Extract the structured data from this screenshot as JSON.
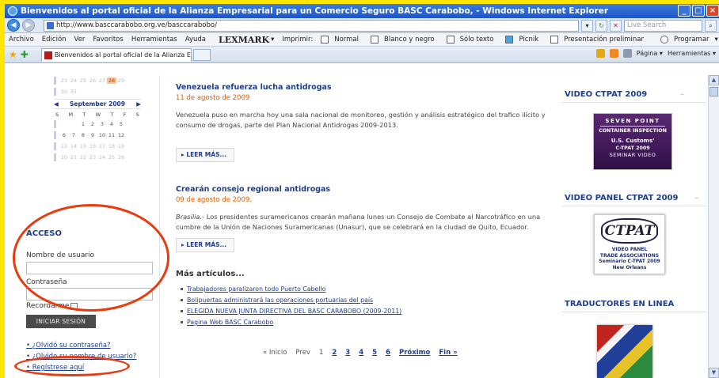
{
  "window": {
    "title": "Bienvenidos al portal oficial de la Alianza Empresarial para un Comercio Seguro BASC Carabobo, - Windows Internet Explorer"
  },
  "address_bar": {
    "url": "http://www.basccarabobo.org.ve/basccarabobo/",
    "search_placeholder": "Live Search"
  },
  "menu": {
    "items": [
      "Archivo",
      "Edición",
      "Ver",
      "Favoritos",
      "Herramientas",
      "Ayuda"
    ],
    "lexmark": "LEXMARK",
    "imprimir": "Imprimir:",
    "normal": "Normal",
    "blanco": "Blanco y negro",
    "solo_texto": "Sólo texto",
    "picnik": "Picnik",
    "presentacion": "Presentación preliminar",
    "programar": "Programar"
  },
  "tabs": {
    "active_label": "Bienvenidos al portal oficial de la Alianza Empresarial p...",
    "pagina": "Página",
    "herramientas": "Herramientas"
  },
  "calendar": {
    "prev_rows": [
      [
        "23",
        "24",
        "25",
        "26",
        "27",
        "28",
        "29"
      ],
      [
        "30",
        "31"
      ]
    ],
    "highlight_day": "28",
    "month": "September 2009",
    "weekdays": [
      "S",
      "M",
      "T",
      "W",
      "T",
      "F",
      "S"
    ],
    "weeks": [
      [
        "",
        "",
        "1",
        "2",
        "3",
        "4",
        "5"
      ],
      [
        "6",
        "7",
        "8",
        "9",
        "10",
        "11",
        "12"
      ],
      [
        "13",
        "14",
        "15",
        "16",
        "17",
        "18",
        "19"
      ],
      [
        "20",
        "21",
        "22",
        "23",
        "24",
        "25",
        "26"
      ]
    ]
  },
  "login": {
    "title": "ACCESO",
    "username_label": "Nombre de usuario",
    "password_label": "Contraseña",
    "remember_label": "Recordarme",
    "submit": "INICIAR SESIÓN",
    "links": [
      "¿Olvidó su contraseña?",
      "¿Olvido su nombre de usuario?",
      "Regístrese aquí"
    ]
  },
  "articles": [
    {
      "title": "Venezuela refuerza lucha antidrogas",
      "date": "11 de agosto de 2009",
      "body": "Venezuela puso en marcha hoy una sala nacional de monitoreo, gestión y análisis estratégico del trafico ilícito y consumo de drogas, parte del Plan Nacional Antidrogas 2009-2013.",
      "more": "LEER MÁS..."
    },
    {
      "title": "Crearán consejo regional antidrogas",
      "date": "09 de agosto de 2009.",
      "lead": "Brasilia.",
      "body": "- Los presidentes suramericanos crearán mañana lunes un Consejo de Combate al Narcotráfico en una cumbre de la Unión de Naciones Suramericanas (Unasur), que se celebrará en la ciudad de Quito, Ecuador.",
      "more": "LEER MÁS..."
    }
  ],
  "more_articles": {
    "title": "Más artículos...",
    "links": [
      "Trabajadores paralizaron todo Puerto Cabello",
      "Bolipuertas administrará las operaciones portuarias del país",
      "ELEGIDA NUEVA JUNTA DIRECTIVA DEL BASC CARABOBO (2009-2011)",
      "Pagina Web BASC Carabobo"
    ]
  },
  "pagination": {
    "start": "« Inicio",
    "prev": "Prev",
    "current": "1",
    "pages": [
      "2",
      "3",
      "4",
      "5",
      "6"
    ],
    "next": "Próximo",
    "end": "Fin »"
  },
  "sidebar": {
    "video1_title": "VIDEO CTPAT 2009",
    "video1_lines": [
      "SEVEN POINT",
      "CONTAINER INSPECTION",
      "U.S. Customs'",
      "C-TPAT 2009",
      "SEMINAR VIDEO"
    ],
    "video2_title": "VIDEO PANEL CTPAT 2009",
    "video2_logo": "CTPAT",
    "video2_lines": [
      "VIDEO PANEL",
      "TRADE ASSOCIATIONS",
      "Seminario C-TPAT 2009",
      "New Orleans"
    ],
    "translators_title": "TRADUCTORES EN LINEA"
  },
  "colors": {
    "annotation_ring": "#e73b10",
    "link_blue": "#1d3e8a",
    "date_orange": "#e65f06",
    "frame_yellow": "#ffe600"
  }
}
